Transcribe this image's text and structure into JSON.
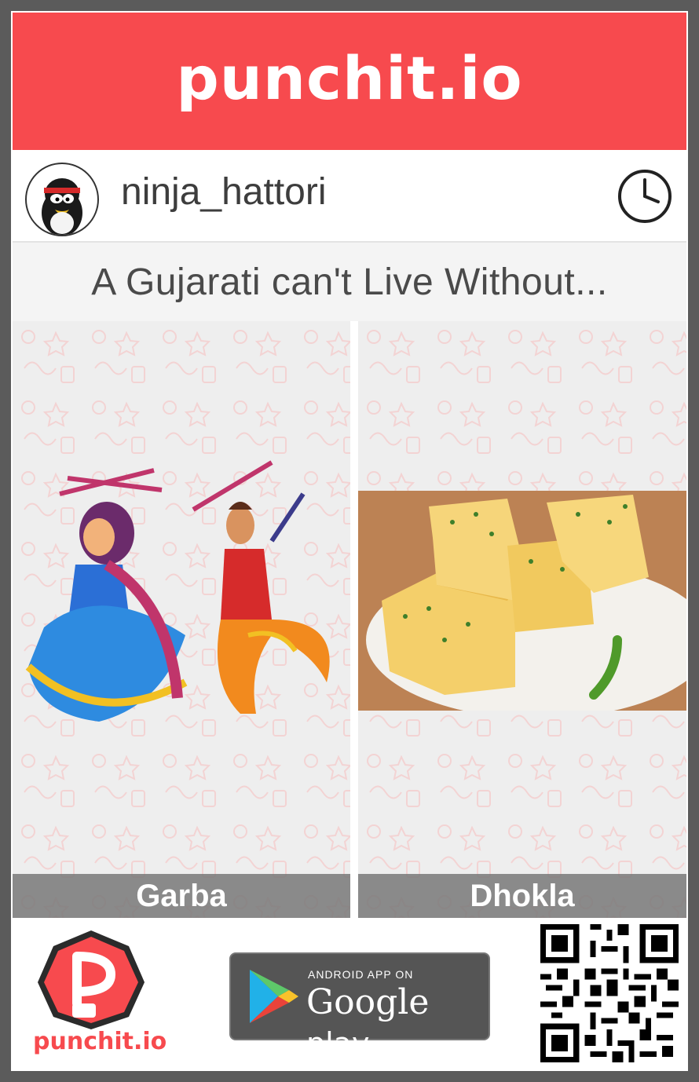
{
  "header": {
    "logo_text": "punchit.io"
  },
  "user": {
    "username": "ninja_hattori"
  },
  "question": {
    "text": "A Gujarati can't Live Without..."
  },
  "options": [
    {
      "label": "Garba"
    },
    {
      "label": "Dhokla"
    }
  ],
  "footer": {
    "logo_text": "punchit.io",
    "store_small": "ANDROID APP ON",
    "store_big_1": "Google",
    "store_big_2": "play"
  },
  "colors": {
    "brand_red": "#f74a4e",
    "caption_bg": "#787878",
    "panel_bg": "#eeeeee"
  },
  "icons": [
    "clock-icon",
    "google-play-icon",
    "qr-code",
    "punchit-app-logo",
    "ninja-avatar"
  ]
}
